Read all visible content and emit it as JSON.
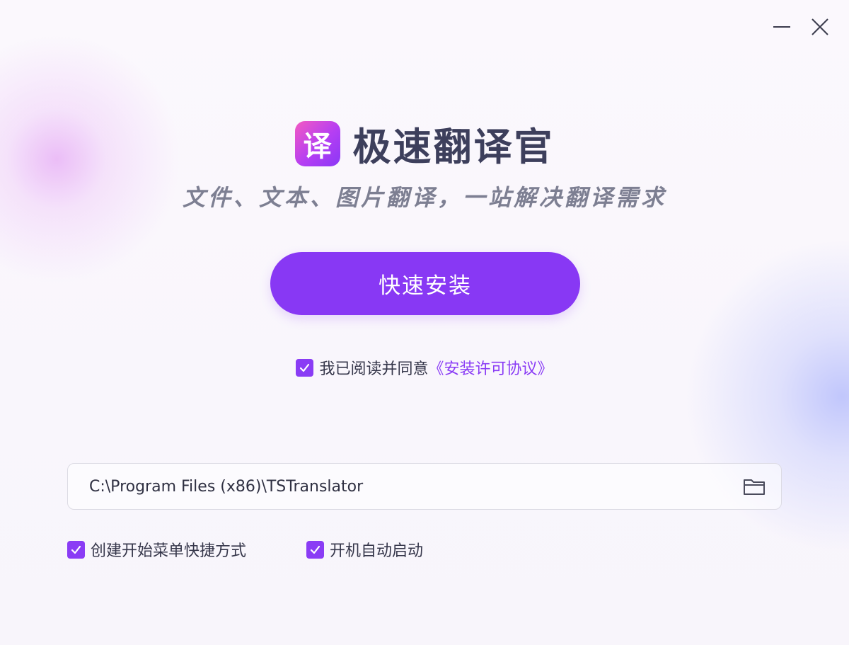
{
  "window": {
    "minimize_icon": "minimize-icon",
    "close_icon": "close-icon"
  },
  "brand": {
    "logo_char": "译",
    "title": "极速翻译官"
  },
  "subtitle": "文件、文本、图片翻译，一站解决翻译需求",
  "install_button": "快速安装",
  "agreement": {
    "checked": true,
    "text": "我已阅读并同意",
    "link": "《安装许可协议》"
  },
  "install_path": {
    "value": "C:\\Program Files (x86)\\TSTranslator",
    "browse_icon": "folder-icon"
  },
  "options": [
    {
      "label": "创建开始菜单快捷方式",
      "checked": true
    },
    {
      "label": "开机自动启动",
      "checked": true
    }
  ],
  "colors": {
    "accent": "#8838f4",
    "title": "#3d3f5c",
    "subtitle": "#7d7f92"
  }
}
